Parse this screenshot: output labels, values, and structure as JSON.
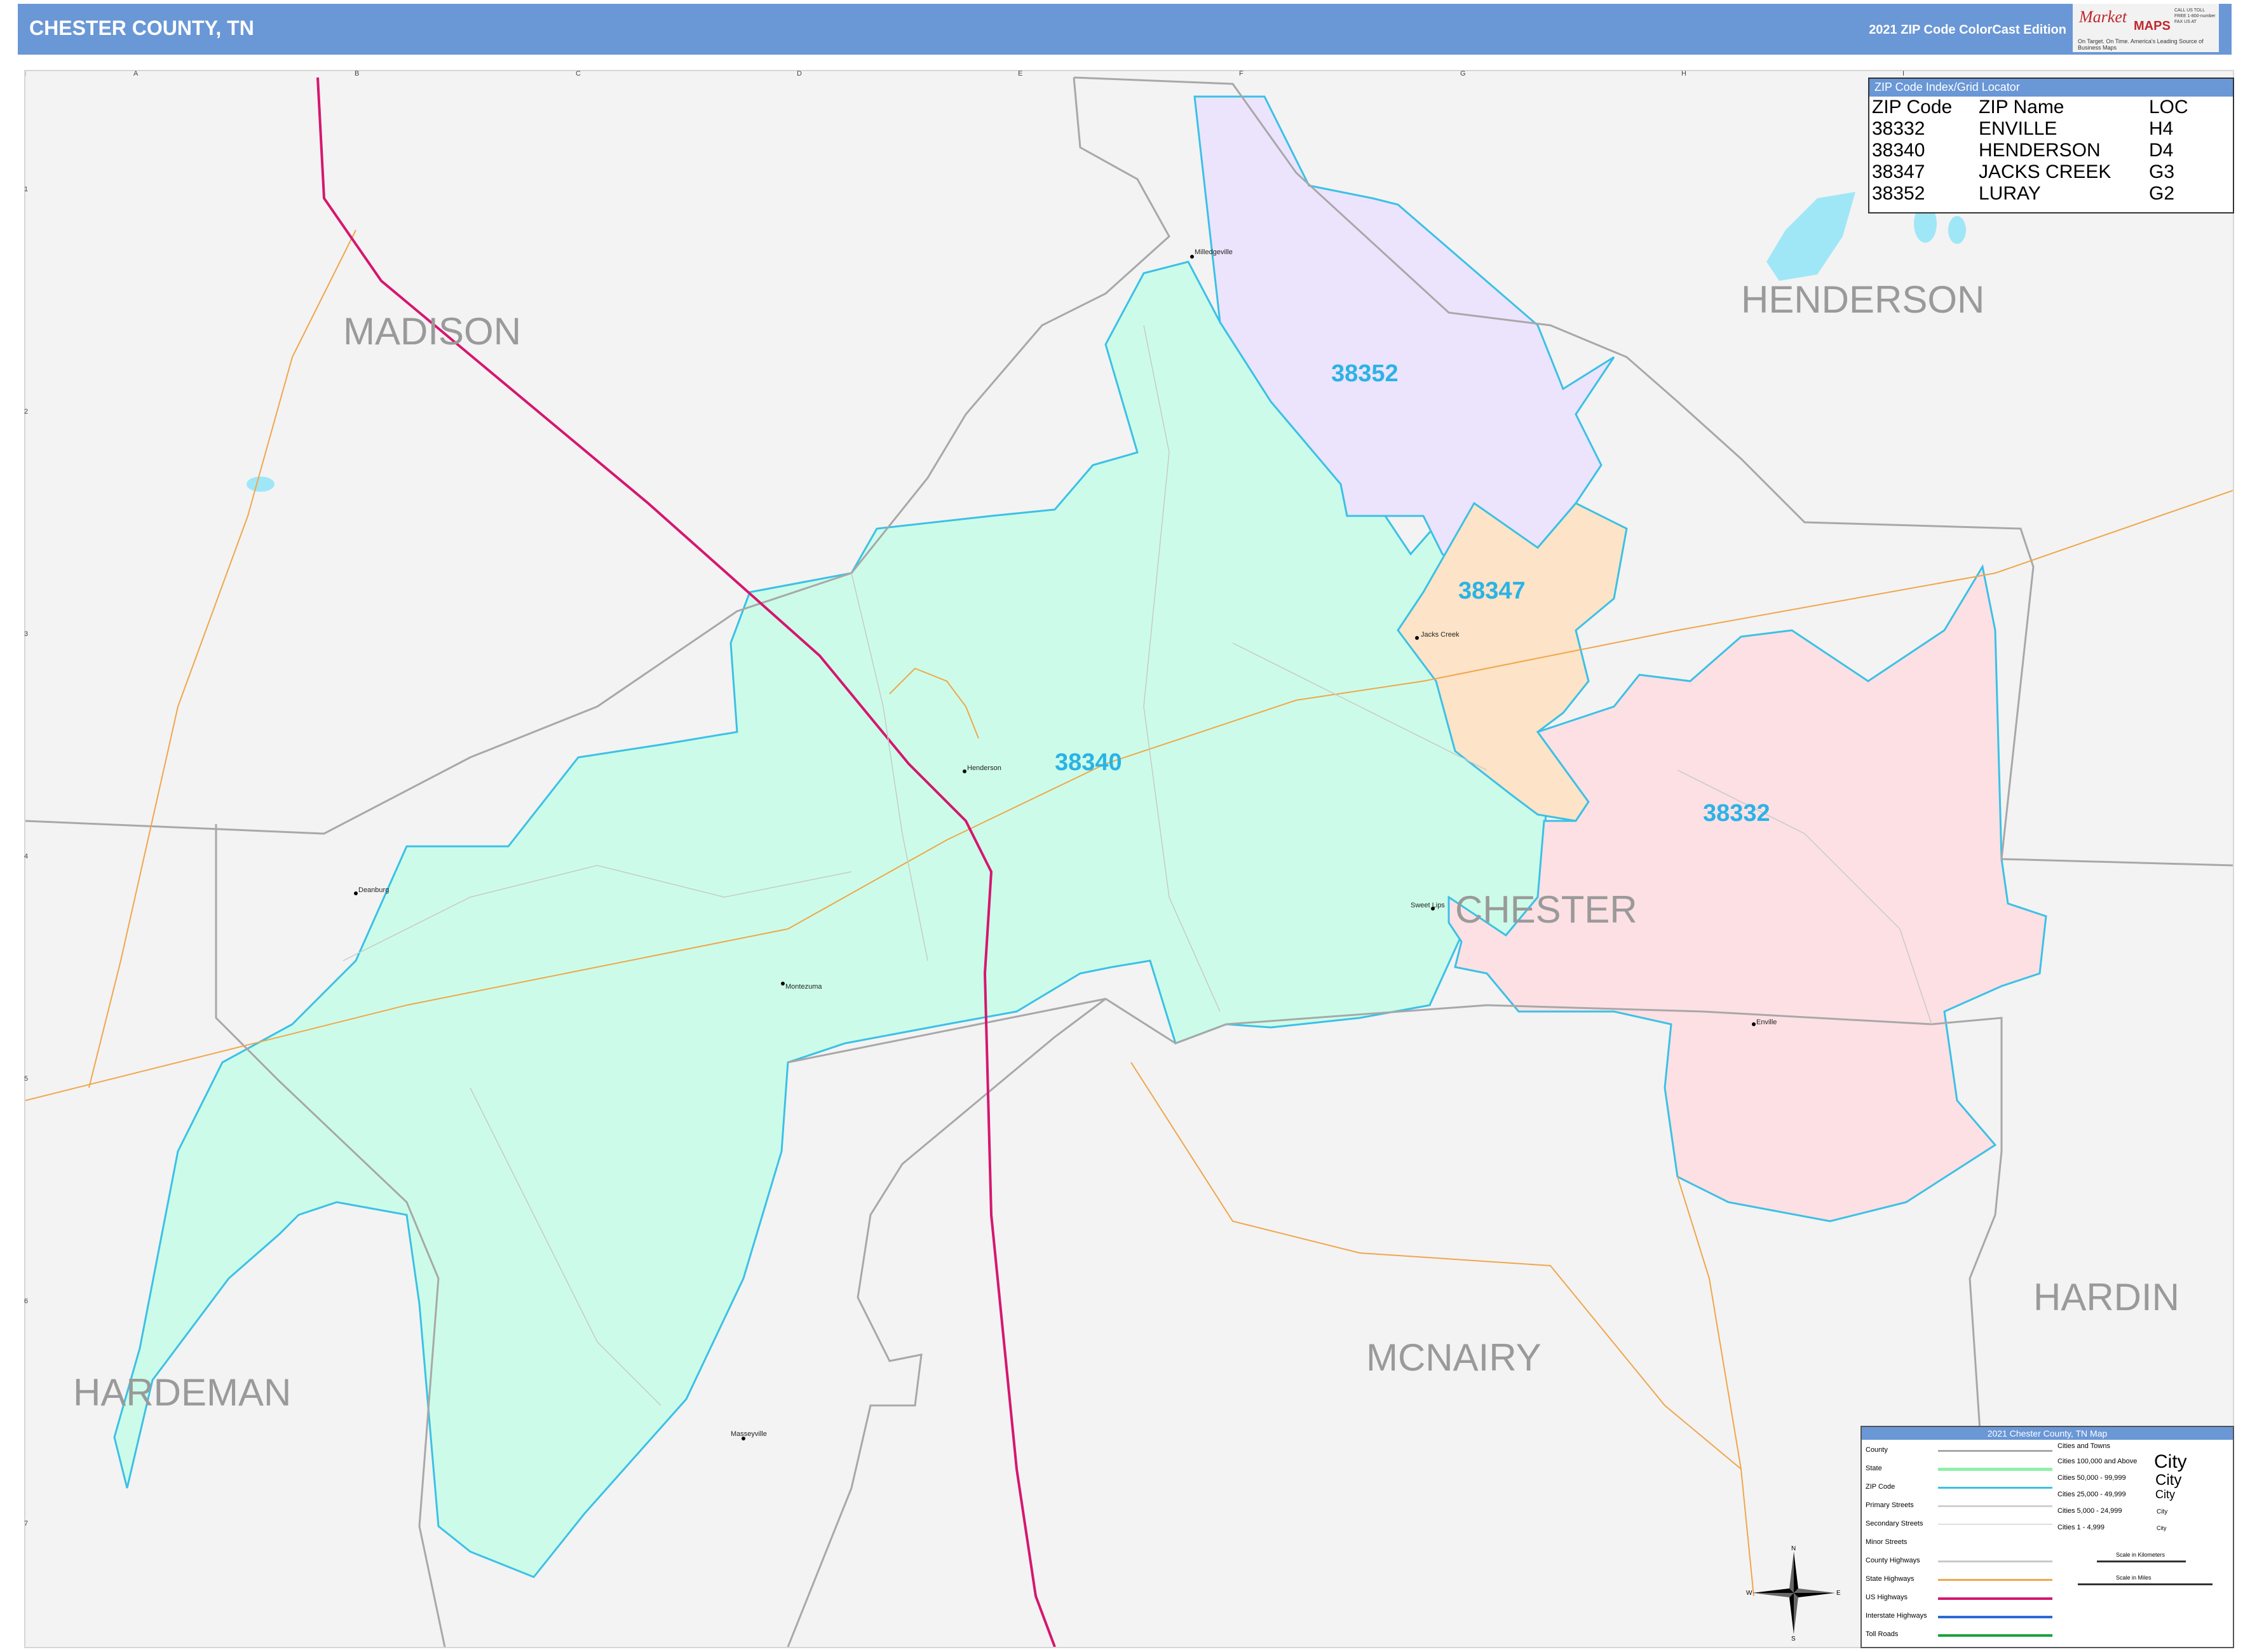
{
  "header": {
    "title": "CHESTER COUNTY, TN",
    "edition": "2021 ZIP Code ColorCast Edition"
  },
  "logo": {
    "brand_a": "Market",
    "brand_b": "MAPS",
    "tagline": "On Target. On Time. America's Leading Source of Business Maps",
    "contact": "CALL US TOLL FREE 1-800-number FAX US AT"
  },
  "grid": {
    "columns": [
      "A",
      "B",
      "C",
      "D",
      "E",
      "F",
      "G",
      "H",
      "I"
    ],
    "rows": [
      "1",
      "2",
      "3",
      "4",
      "5",
      "6",
      "7"
    ]
  },
  "county_labels": [
    "MADISON",
    "HENDERSON",
    "CHESTER",
    "HARDEMAN",
    "MCNAIRY",
    "HARDIN"
  ],
  "zip_labels": [
    "38352",
    "38340",
    "38347",
    "38332"
  ],
  "towns": [
    "Milledgeville",
    "Jacks Creek",
    "Henderson",
    "Enville",
    "Deanburg",
    "Sweet Lips",
    "Montezuma",
    "Masseyville"
  ],
  "colors": {
    "header": "#6a97d6",
    "zip_38340": "#ccfce9",
    "zip_38352": "#ece4fc",
    "zip_38347": "#fde3c7",
    "zip_38332": "#fde0e4",
    "zip_border": "#3bc1e6",
    "county_border": "#a8a8a8",
    "us_highway": "#d6166f",
    "state_highway": "#f0a64b",
    "label_zip": "#2ab3e6"
  },
  "zip_index": {
    "title": "ZIP Code Index/Grid Locator",
    "columns": [
      "ZIP Code",
      "ZIP Name",
      "LOC"
    ],
    "rows": [
      [
        "38332",
        "ENVILLE",
        "H4"
      ],
      [
        "38340",
        "HENDERSON",
        "D4"
      ],
      [
        "38347",
        "JACKS CREEK",
        "G3"
      ],
      [
        "38352",
        "LURAY",
        "G2"
      ]
    ]
  },
  "legend": {
    "title": "2021 Chester County, TN Map",
    "items": [
      "County",
      "State",
      "ZIP Code",
      "Primary Streets",
      "Secondary Streets",
      "Minor Streets",
      "County Highways",
      "State Highways",
      "US Highways",
      "Interstate Highways",
      "Toll Roads"
    ],
    "cities_title": "Cities and Towns",
    "city_classes": [
      "Cities 100,000 and Above",
      "Cities 50,000 - 99,999",
      "Cities 25,000 - 49,999",
      "Cities 5,000 - 24,999",
      "Cities 1 - 4,999"
    ],
    "city_samples": [
      "City",
      "City",
      "City",
      "City",
      "City"
    ],
    "scale_km": "Scale in Kilometers",
    "scale_mi": "Scale in Miles"
  },
  "compass": [
    "N",
    "S",
    "E",
    "W"
  ]
}
